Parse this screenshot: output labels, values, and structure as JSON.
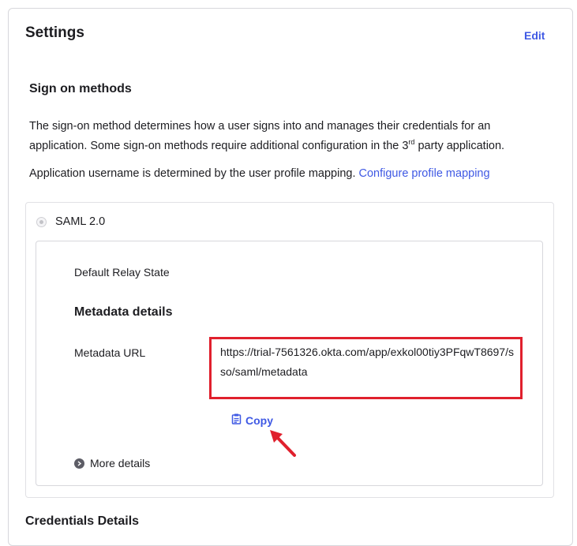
{
  "settings": {
    "title": "Settings",
    "edit_label": "Edit"
  },
  "sign_on": {
    "title": "Sign on methods",
    "description_part1": "The sign-on method determines how a user signs into and manages their credentials for an application. Some sign-on methods require additional configuration in the 3",
    "description_sup": "rd",
    "description_part2": " party application.",
    "username_text": "Application username is determined by the user profile mapping. ",
    "configure_link": "Configure profile mapping"
  },
  "saml": {
    "label": "SAML 2.0",
    "relay_state_label": "Default Relay State",
    "metadata_title": "Metadata details",
    "metadata_url_label": "Metadata URL",
    "metadata_url_value": "https://trial-7561326.okta.com/app/exkol00tiy3PFqwT8697/sso/saml/metadata",
    "copy_label": "Copy",
    "more_details_label": "More details"
  },
  "credentials": {
    "title": "Credentials Details"
  },
  "colors": {
    "link": "#3f59e4",
    "highlight": "#e0202d"
  },
  "icons": {
    "copy": "clipboard-icon",
    "more": "chevron-right-circle-icon"
  }
}
